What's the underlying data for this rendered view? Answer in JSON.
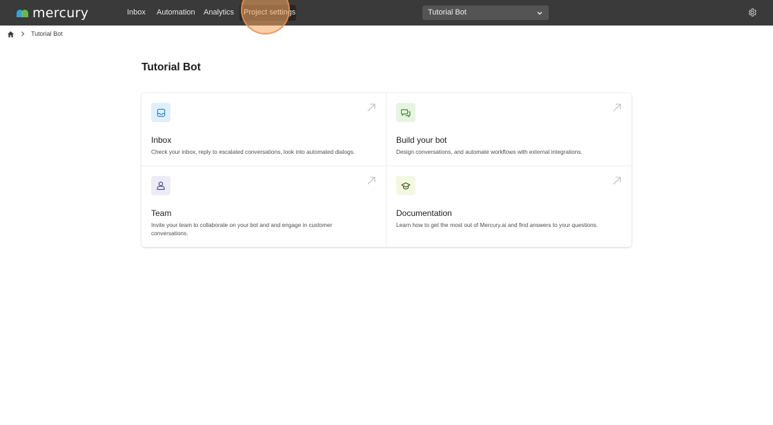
{
  "app": {
    "logo_text": "mercury",
    "nav": [
      {
        "label": "Inbox"
      },
      {
        "label": "Automation"
      },
      {
        "label": "Analytics"
      },
      {
        "label": "Project settings"
      }
    ],
    "bot_selector": {
      "value": "Tutorial Bot",
      "icon": "chevron-down-icon"
    },
    "settings_icon": "gear-icon"
  },
  "breadcrumb": {
    "home_icon": "home-icon",
    "current": "Tutorial Bot"
  },
  "page": {
    "title": "Tutorial Bot"
  },
  "cards": [
    {
      "title": "Inbox",
      "description": "Check your inbox, reply to escalated conversations, look into automated dialogs.",
      "icon": "inbox-icon",
      "icon_bg": "#dff0fb",
      "icon_color": "#2a86c8"
    },
    {
      "title": "Build your bot",
      "description": "Design conversations, and automate workflows with external integrations.",
      "icon": "chat-bubbles-icon",
      "icon_bg": "#e6f5e1",
      "icon_color": "#3c8a2e"
    },
    {
      "title": "Team",
      "description": "Invite your team to collaborate on your bot and and engage in customer conversations.",
      "icon": "team-icon",
      "icon_bg": "#ecebf6",
      "icon_color": "#4b4a8f"
    },
    {
      "title": "Documentation",
      "description": "Learn how to get the most out of Mercury.ai and find answers to your questions.",
      "icon": "graduation-cap-icon",
      "icon_bg": "#f3f8e3",
      "icon_color": "#3f5a1e"
    }
  ],
  "colors": {
    "topbar": "#3a3a3a",
    "highlight": "#f5a55f"
  }
}
